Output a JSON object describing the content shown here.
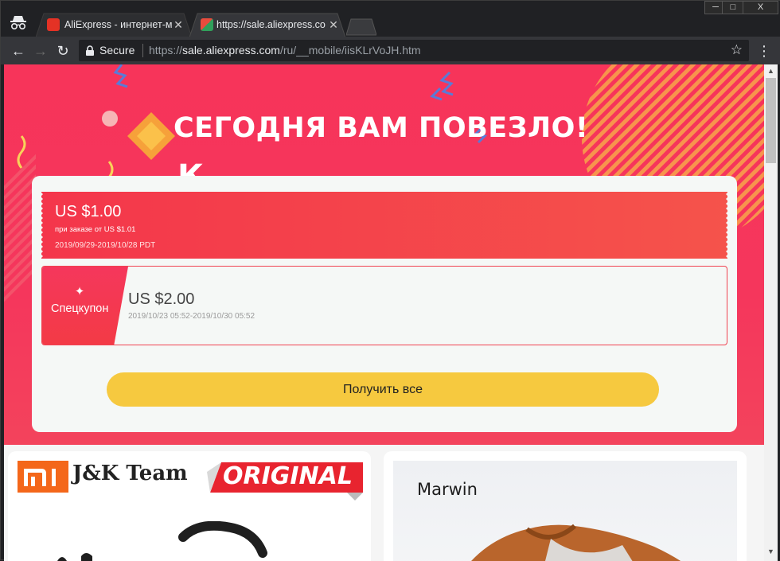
{
  "browser": {
    "tabs": [
      {
        "title": "AliExpress - интернет-м",
        "active": false,
        "favicon": "aliexpress-favicon"
      },
      {
        "title": "https://sale.aliexpress.co",
        "active": true,
        "favicon": "aliexpress-sale-favicon"
      }
    ],
    "window_controls": {
      "minimize": "─",
      "maximize": "□",
      "close": "X"
    },
    "nav": {
      "back": "←",
      "forward": "→",
      "reload": "↻"
    },
    "address": {
      "secure_label": "Secure",
      "scheme": "https://",
      "host": "sale.aliexpress.com",
      "path": "/ru/__mobile/iisKLrVoJH.htm"
    },
    "star": "☆",
    "menu": "⋮"
  },
  "page": {
    "hero_title": "СЕГОДНЯ ВАМ ПОВЕЗЛО!",
    "hero_partial": "К",
    "coupons": [
      {
        "amount": "US $1.00",
        "condition": "при заказе от US $1.01",
        "dates": "2019/09/29-2019/10/28 PDT"
      },
      {
        "badge": "Спецкупон",
        "amount": "US $2.00",
        "dates": "2019/10/23 05:52-2019/10/30 05:52"
      }
    ],
    "get_all_label": "Получить все",
    "products": [
      {
        "brand_text": "J&K Team",
        "tag": "ORIGINAL"
      },
      {
        "brand_text": "Marwin"
      }
    ]
  },
  "colors": {
    "hero": "#f5365c",
    "coupon_red": "#f4364b",
    "button_yellow": "#f6c93f",
    "chrome_dark": "#202124",
    "toolbar": "#35363a"
  }
}
